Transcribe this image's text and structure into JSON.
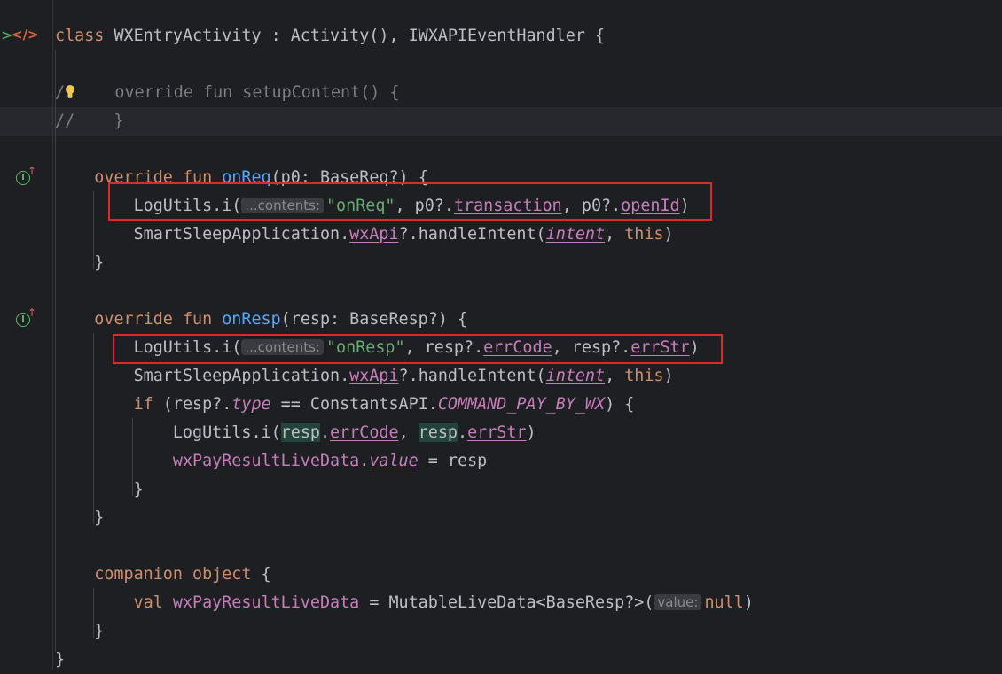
{
  "editor": {
    "gutter": {
      "class_marker": ">",
      "tag_icon": "</>",
      "impl_icon": "I",
      "override_arrow": "↑"
    },
    "hints": {
      "contents": "...contents:",
      "value": "value:"
    },
    "lines": [
      [
        [
          "t-kw",
          "class "
        ],
        [
          "",
          "WXEntryActivity : Activity(), IWXAPIEventHandler {"
        ]
      ],
      [],
      [
        [
          "t-comment",
          "/"
        ],
        [
          "bulb",
          ""
        ],
        [
          "t-comment",
          "    override fun setupContent() {"
        ]
      ],
      [
        [
          "t-comment",
          "//    }"
        ],
        [
          "caret",
          ""
        ]
      ],
      [],
      [
        [
          "",
          "    "
        ],
        [
          "t-kw",
          "override fun "
        ],
        [
          "t-fn",
          "onReq"
        ],
        [
          "",
          "(p0: BaseReq?) {"
        ]
      ],
      [
        [
          "",
          "        LogUtils.i("
        ],
        [
          "hint",
          "contents"
        ],
        [
          "t-str",
          "\"onReq\""
        ],
        [
          "",
          ", p0?."
        ],
        [
          "t-prop-u",
          "transaction"
        ],
        [
          "",
          ", p0?."
        ],
        [
          "t-prop-u",
          "openId"
        ],
        [
          "",
          ")"
        ]
      ],
      [
        [
          "",
          "        SmartSleepApplication."
        ],
        [
          "t-prop-u",
          "wxApi"
        ],
        [
          "",
          "?.handleIntent("
        ],
        [
          "t-prop-iu",
          "intent"
        ],
        [
          "",
          ", "
        ],
        [
          "t-kw",
          "this"
        ],
        [
          "",
          ")"
        ]
      ],
      [
        [
          "",
          "    }"
        ]
      ],
      [],
      [
        [
          "",
          "    "
        ],
        [
          "t-kw",
          "override fun "
        ],
        [
          "t-fn",
          "onResp"
        ],
        [
          "",
          "(resp: BaseResp?) {"
        ]
      ],
      [
        [
          "",
          "        LogUtils.i("
        ],
        [
          "hint",
          "contents"
        ],
        [
          "t-str",
          "\"onResp\""
        ],
        [
          "",
          ", resp?."
        ],
        [
          "t-prop-u",
          "errCode"
        ],
        [
          "",
          ", resp?."
        ],
        [
          "t-prop-u",
          "errStr"
        ],
        [
          "",
          ")"
        ]
      ],
      [
        [
          "",
          "        SmartSleepApplication."
        ],
        [
          "t-prop-u",
          "wxApi"
        ],
        [
          "",
          "?.handleIntent("
        ],
        [
          "t-prop-iu",
          "intent"
        ],
        [
          "",
          ", "
        ],
        [
          "t-kw",
          "this"
        ],
        [
          "",
          ")"
        ]
      ],
      [
        [
          "",
          "        "
        ],
        [
          "t-kw",
          "if "
        ],
        [
          "",
          "(resp?."
        ],
        [
          "t-prop-i",
          "type"
        ],
        [
          "",
          " == ConstantsAPI."
        ],
        [
          "t-const",
          "COMMAND_PAY_BY_WX"
        ],
        [
          "",
          ") {"
        ]
      ],
      [
        [
          "",
          "            LogUtils.i("
        ],
        [
          "t-hl",
          "resp"
        ],
        [
          "",
          "."
        ],
        [
          "t-prop-u",
          "errCode"
        ],
        [
          "",
          ", "
        ],
        [
          "t-hl",
          "resp"
        ],
        [
          "",
          "."
        ],
        [
          "t-prop-u",
          "errStr"
        ],
        [
          "",
          ")"
        ]
      ],
      [
        [
          "",
          "            "
        ],
        [
          "t-prop",
          "wxPayResultLiveData"
        ],
        [
          "",
          "."
        ],
        [
          "t-prop-iu",
          "value"
        ],
        [
          "",
          " = resp"
        ]
      ],
      [
        [
          "",
          "        }"
        ]
      ],
      [
        [
          "",
          "    }"
        ]
      ],
      [],
      [
        [
          "",
          "    "
        ],
        [
          "t-kw",
          "companion object "
        ],
        [
          "",
          "{"
        ]
      ],
      [
        [
          "",
          "        "
        ],
        [
          "t-kw",
          "val "
        ],
        [
          "t-prop",
          "wxPayResultLiveData"
        ],
        [
          "",
          " = MutableLiveData<BaseResp?>("
        ],
        [
          "hint",
          "value"
        ],
        [
          "t-kw",
          "null"
        ],
        [
          "",
          ")"
        ]
      ],
      [
        [
          "",
          "    }"
        ]
      ],
      [
        [
          "",
          "}"
        ]
      ]
    ]
  }
}
